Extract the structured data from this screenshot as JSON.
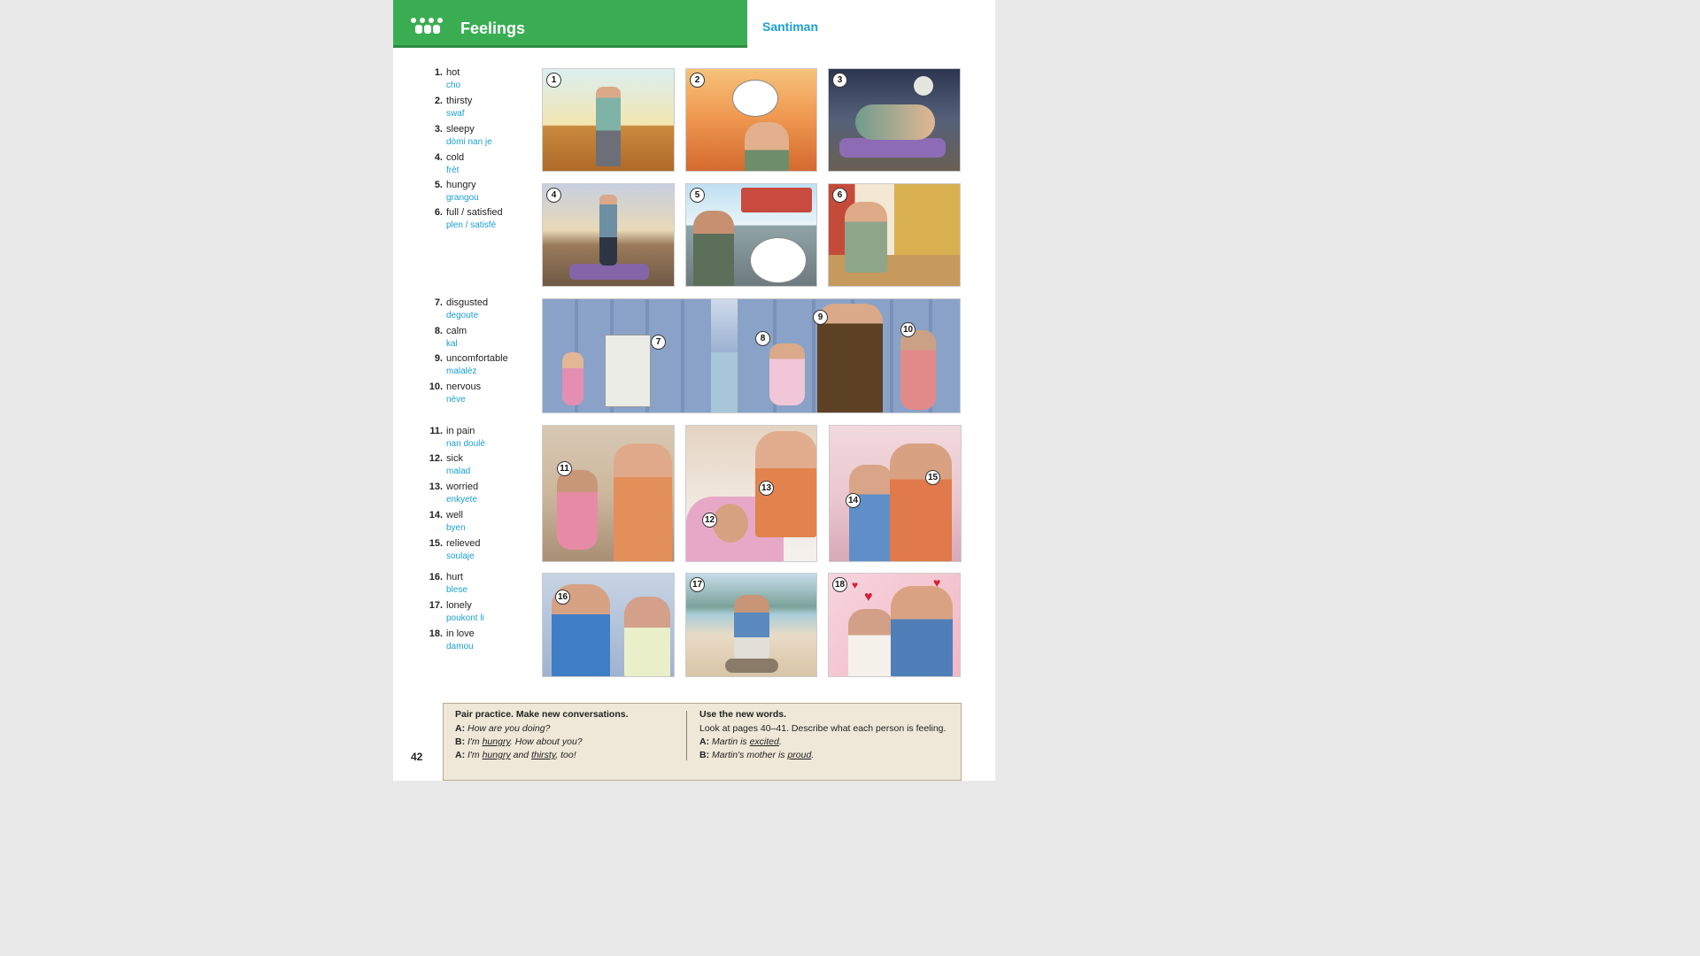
{
  "header": {
    "title": "Feelings",
    "subtitle": "Santiman"
  },
  "page_number": "42",
  "vocab": [
    {
      "num": "1.",
      "en": "hot",
      "ht": "cho"
    },
    {
      "num": "2.",
      "en": "thirsty",
      "ht": "swaf"
    },
    {
      "num": "3.",
      "en": "sleepy",
      "ht": "dòmi nan je"
    },
    {
      "num": "4.",
      "en": "cold",
      "ht": "frèt"
    },
    {
      "num": "5.",
      "en": "hungry",
      "ht": "grangou"
    },
    {
      "num": "6.",
      "en": "full / satisfied",
      "ht": "plen / satisfè"
    },
    {
      "num": "7.",
      "en": "disgusted",
      "ht": "degoute"
    },
    {
      "num": "8.",
      "en": "calm",
      "ht": "kal"
    },
    {
      "num": "9.",
      "en": "uncomfortable",
      "ht": "malalèz"
    },
    {
      "num": "10.",
      "en": "nervous",
      "ht": "nève"
    },
    {
      "num": "11.",
      "en": "in pain",
      "ht": "nan doulè"
    },
    {
      "num": "12.",
      "en": "sick",
      "ht": "malad"
    },
    {
      "num": "13.",
      "en": "worried",
      "ht": "enkyete"
    },
    {
      "num": "14.",
      "en": "well",
      "ht": "byen"
    },
    {
      "num": "15.",
      "en": "relieved",
      "ht": "soulaje"
    },
    {
      "num": "16.",
      "en": "hurt",
      "ht": "blese"
    },
    {
      "num": "17.",
      "en": "lonely",
      "ht": "poukont li"
    },
    {
      "num": "18.",
      "en": "in love",
      "ht": "damou"
    }
  ],
  "badges": [
    "1",
    "2",
    "3",
    "4",
    "5",
    "6",
    "7",
    "8",
    "9",
    "10",
    "11",
    "12",
    "13",
    "14",
    "15",
    "16",
    "17",
    "18"
  ],
  "practice": {
    "left_heading": "Pair practice. Make new conversations.",
    "left_lines": [
      {
        "speaker": "A:",
        "parts": [
          {
            "t": "How are you doing?",
            "u": false
          }
        ]
      },
      {
        "speaker": "B:",
        "parts": [
          {
            "t": "I'm ",
            "u": false
          },
          {
            "t": "hungry",
            "u": true
          },
          {
            "t": ". How about you?",
            "u": false
          }
        ]
      },
      {
        "speaker": "A:",
        "parts": [
          {
            "t": "I'm ",
            "u": false
          },
          {
            "t": "hungry",
            "u": true
          },
          {
            "t": " and ",
            "u": false
          },
          {
            "t": "thirsty",
            "u": true
          },
          {
            "t": ", too!",
            "u": false
          }
        ]
      }
    ],
    "right_heading": "Use the new words.",
    "right_intro": "Look at pages 40–41. Describe what each person is feeling.",
    "right_lines": [
      {
        "speaker": "A:",
        "parts": [
          {
            "t": "Martin is ",
            "u": false
          },
          {
            "t": "excited",
            "u": true
          },
          {
            "t": ".",
            "u": false
          }
        ]
      },
      {
        "speaker": "B:",
        "parts": [
          {
            "t": "Martin's mother is ",
            "u": false
          },
          {
            "t": "proud",
            "u": true
          },
          {
            "t": ".",
            "u": false
          }
        ]
      }
    ]
  },
  "colors": {
    "header_green": "#3aad52",
    "accent_blue": "#1a9fd0",
    "practice_bg": "#efe7d7"
  }
}
